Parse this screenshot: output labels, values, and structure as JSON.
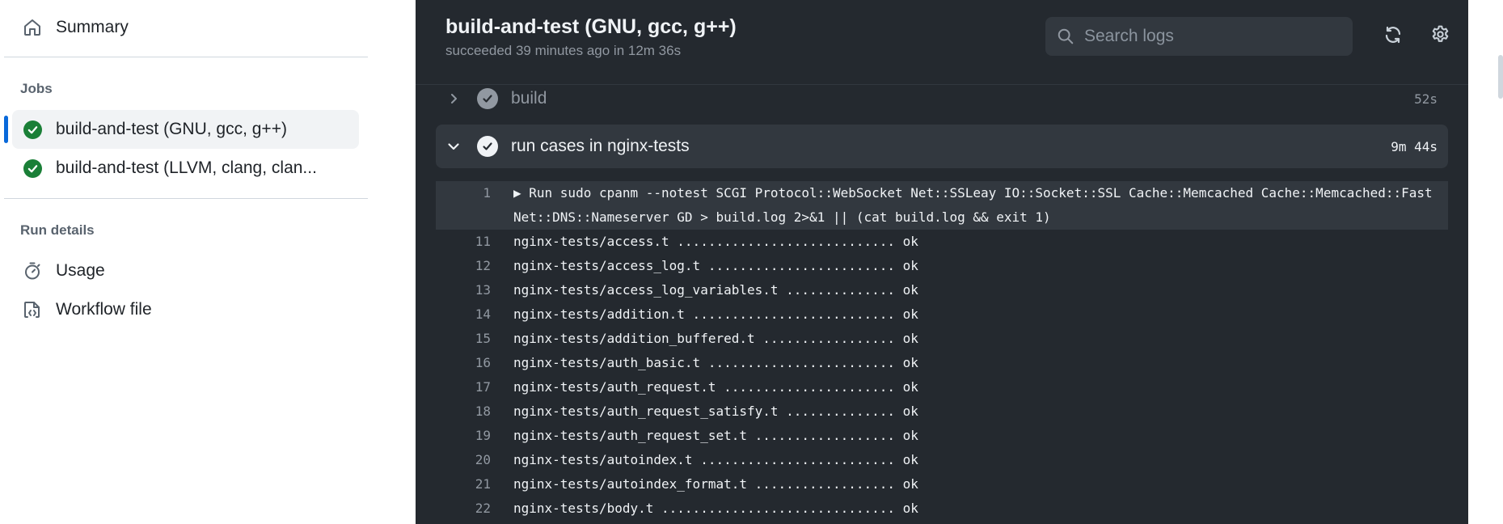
{
  "sidebar": {
    "summary_label": "Summary",
    "jobs_heading": "Jobs",
    "jobs": [
      {
        "label": "build-and-test (GNU, gcc, g++)",
        "status": "success",
        "active": true
      },
      {
        "label": "build-and-test (LLVM, clang, clan...",
        "status": "success",
        "active": false
      }
    ],
    "run_details_heading": "Run details",
    "usage_label": "Usage",
    "workflow_file_label": "Workflow file"
  },
  "header": {
    "title": "build-and-test (GNU, gcc, g++)",
    "subtitle": "succeeded 39 minutes ago in 12m 36s",
    "search_placeholder": "Search logs"
  },
  "steps": [
    {
      "name": "build",
      "duration": "52s",
      "expanded": false
    },
    {
      "name": "run cases in nginx-tests",
      "duration": "9m 44s",
      "expanded": true
    }
  ],
  "log": {
    "first_line": {
      "number": "1",
      "text_1": "▶ Run sudo cpanm --notest SCGI Protocol::WebSocket Net::SSLeay IO::Socket::SSL Cache::Memcached Cache::Memcached::Fast",
      "text_2": "Net::DNS::Nameserver GD > build.log 2>&1 || (cat build.log && exit 1)"
    },
    "lines": [
      {
        "number": "11",
        "text": "nginx-tests/access.t ............................ ok"
      },
      {
        "number": "12",
        "text": "nginx-tests/access_log.t ........................ ok"
      },
      {
        "number": "13",
        "text": "nginx-tests/access_log_variables.t .............. ok"
      },
      {
        "number": "14",
        "text": "nginx-tests/addition.t .......................... ok"
      },
      {
        "number": "15",
        "text": "nginx-tests/addition_buffered.t ................. ok"
      },
      {
        "number": "16",
        "text": "nginx-tests/auth_basic.t ........................ ok"
      },
      {
        "number": "17",
        "text": "nginx-tests/auth_request.t ...................... ok"
      },
      {
        "number": "18",
        "text": "nginx-tests/auth_request_satisfy.t .............. ok"
      },
      {
        "number": "19",
        "text": "nginx-tests/auth_request_set.t .................. ok"
      },
      {
        "number": "20",
        "text": "nginx-tests/autoindex.t ......................... ok"
      },
      {
        "number": "21",
        "text": "nginx-tests/autoindex_format.t .................. ok"
      },
      {
        "number": "22",
        "text": "nginx-tests/body.t .............................. ok"
      }
    ]
  },
  "colors": {
    "success": "#1a7f37",
    "accent": "#0969da",
    "log_bg": "#24292f",
    "log_highlight": "#32383f"
  }
}
